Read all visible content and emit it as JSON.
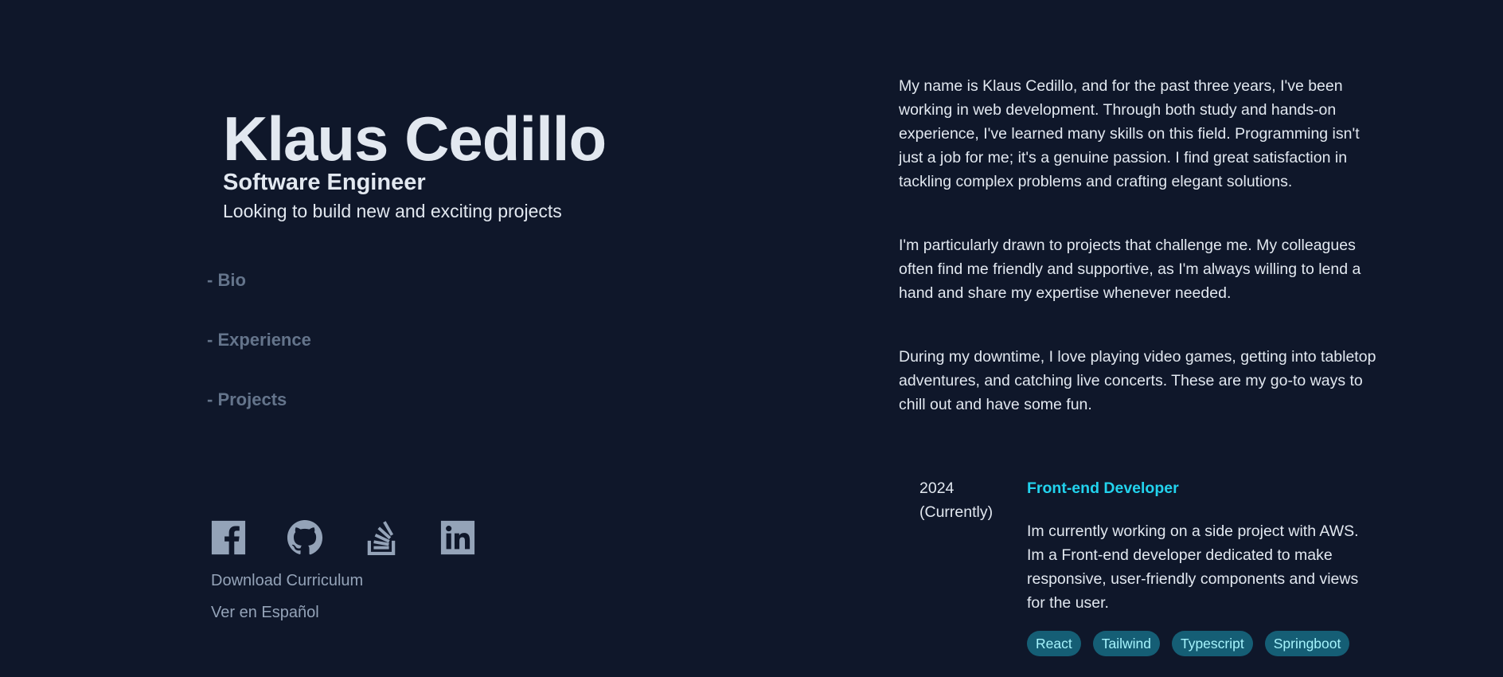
{
  "header": {
    "name": "Klaus Cedillo",
    "role": "Software Engineer",
    "tagline": "Looking to build new and exciting projects"
  },
  "nav": {
    "items": [
      {
        "label": "- Bio"
      },
      {
        "label": "- Experience"
      },
      {
        "label": "- Projects"
      }
    ]
  },
  "socials": [
    {
      "icon": "facebook-icon"
    },
    {
      "icon": "github-icon"
    },
    {
      "icon": "stackoverflow-icon"
    },
    {
      "icon": "linkedin-icon"
    }
  ],
  "links": {
    "download_cv": "Download Curriculum",
    "spanish": "Ver en Español"
  },
  "bio": {
    "paragraphs": [
      "My name is Klaus Cedillo, and for the past three years, I've been working in web development. Through both study and hands-on experience, I've learned many skills on this field. Programming isn't just a job for me; it's a genuine passion. I find great satisfaction in tackling complex problems and crafting elegant solutions.",
      "I'm particularly drawn to projects that challenge me. My colleagues often find me friendly and supportive, as I'm always willing to lend a hand and share my expertise whenever needed.",
      "During my downtime, I love playing video games, getting into tabletop adventures, and catching live concerts. These are my go-to ways to chill out and have some fun."
    ]
  },
  "experience": [
    {
      "year": "2024",
      "status": "(Currently)",
      "title": "Front-end Developer",
      "description": "Im currently working on a side project with AWS. Im a Front-end developer dedicated to make responsive, user-friendly components and views for the user.",
      "tags": [
        "React",
        "Tailwind",
        "Typescript",
        "Springboot"
      ]
    }
  ],
  "colors": {
    "background": "#0f172a",
    "text": "#e2e8f0",
    "muted": "#64748b",
    "icon": "#94a3b8",
    "accent": "#22d3ee",
    "tag_bg": "#155e75",
    "tag_text": "#a5f3fc"
  }
}
